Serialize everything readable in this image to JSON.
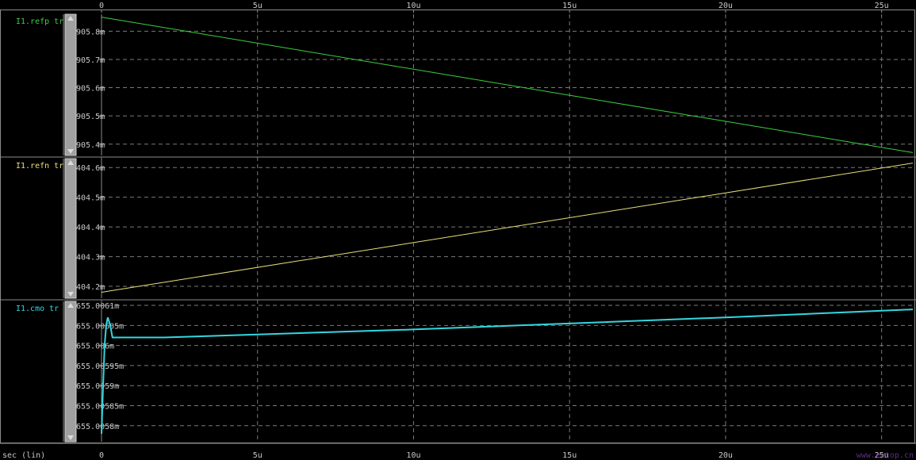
{
  "colors": {
    "background": "#000000",
    "grid": "#7a7a7a",
    "border": "#8c8c8c",
    "axis_text": "#c8c8c8",
    "scrollbar": "#a0a0a0"
  },
  "x_axis": {
    "label": "sec (lin)",
    "ticks": [
      "0",
      "5u",
      "10u",
      "15u",
      "20u",
      "25u"
    ],
    "tick_values": [
      0,
      5,
      10,
      15,
      20,
      25
    ],
    "range": [
      0,
      26
    ]
  },
  "watermark": "www.eetop.cn",
  "chart_data": [
    {
      "type": "line",
      "name": "I1.refp tr",
      "color": "#3ecf3e",
      "x_unit": "u",
      "y_unit": "m",
      "y_ticks": [
        "905.8m",
        "905.7m",
        "905.6m",
        "905.5m",
        "905.4m"
      ],
      "y_tick_values": [
        905.8,
        905.7,
        905.6,
        905.5,
        905.4
      ],
      "ylim": [
        905.36,
        905.86
      ],
      "points": [
        [
          0,
          905.85
        ],
        [
          26,
          905.37
        ]
      ]
    },
    {
      "type": "line",
      "name": "I1.refn tr",
      "color": "#e8e07a",
      "x_unit": "u",
      "y_unit": "m",
      "y_ticks": [
        "404.6m",
        "404.5m",
        "404.4m",
        "404.3m",
        "404.2m"
      ],
      "y_tick_values": [
        404.6,
        404.5,
        404.4,
        404.3,
        404.2
      ],
      "ylim": [
        404.16,
        404.63
      ],
      "points": [
        [
          0,
          404.18
        ],
        [
          26,
          404.615
        ]
      ]
    },
    {
      "type": "line",
      "name": "I1.cmo tr",
      "color": "#35d6e0",
      "x_unit": "u",
      "y_unit": "m",
      "y_ticks": [
        "655.0061m",
        "655.00605m",
        "655.006m",
        "655.00595m",
        "655.0059m",
        "655.00585m",
        "655.0058m"
      ],
      "y_tick_values": [
        655.0061,
        655.00605,
        655.006,
        655.00595,
        655.0059,
        655.00585,
        655.0058
      ],
      "ylim": [
        655.00576,
        655.00611
      ],
      "points": [
        [
          0,
          655.00578
        ],
        [
          0.05,
          655.0059
        ],
        [
          0.1,
          655.006
        ],
        [
          0.15,
          655.00605
        ],
        [
          0.2,
          655.00607
        ],
        [
          0.28,
          655.00605
        ],
        [
          0.35,
          655.00602
        ],
        [
          0.5,
          655.00602
        ],
        [
          2,
          655.00602
        ],
        [
          10,
          655.00604
        ],
        [
          20,
          655.00607
        ],
        [
          26,
          655.00609
        ]
      ]
    }
  ]
}
